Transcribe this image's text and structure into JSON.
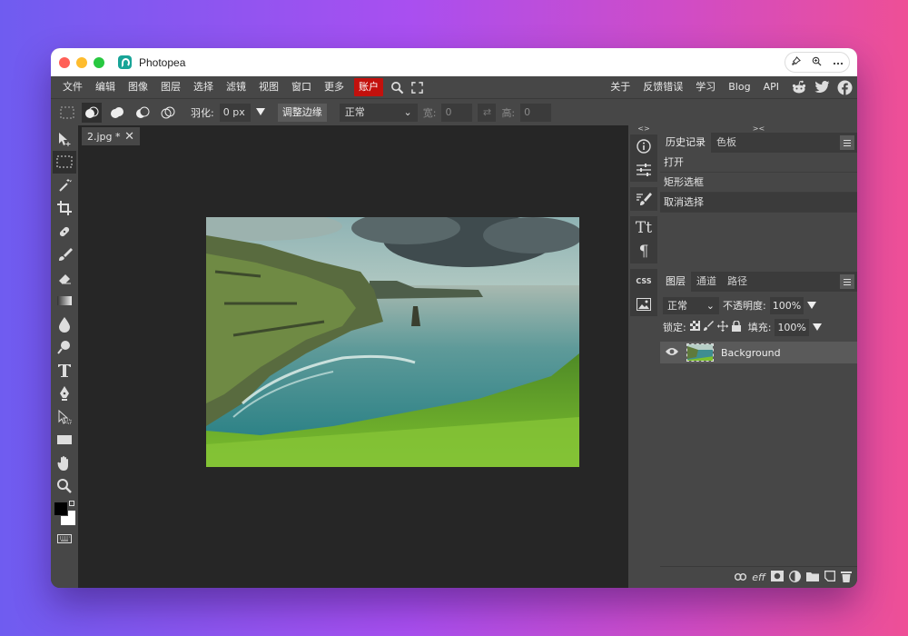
{
  "window": {
    "title": "Photopea",
    "title_buttons": [
      "pin-icon",
      "zoom-icon",
      "more-icon"
    ]
  },
  "menu": {
    "items": [
      "文件",
      "编辑",
      "图像",
      "图层",
      "选择",
      "滤镜",
      "视图",
      "窗口",
      "更多"
    ],
    "account": "账户",
    "right_items": [
      "关于",
      "反馈错误",
      "学习",
      "Blog",
      "API"
    ],
    "account_color": "#c3110d"
  },
  "options": {
    "feather_label": "羽化:",
    "feather_value": "0 px",
    "refine_edge": "调整边缘",
    "style_value": "正常",
    "width_label": "宽:",
    "width_value": "0",
    "height_label": "高:",
    "height_value": "0"
  },
  "document": {
    "tab_name": "2.jpg *"
  },
  "history": {
    "tabs": [
      "历史记录",
      "色板"
    ],
    "items": [
      "打开",
      "矩形选框",
      "取消选择"
    ]
  },
  "layers": {
    "tabs": [
      "图层",
      "通道",
      "路径"
    ],
    "blend_mode": "正常",
    "opacity_label": "不透明度:",
    "opacity_value": "100%",
    "lock_label": "锁定:",
    "fill_label": "填充:",
    "fill_value": "100%",
    "items": [
      {
        "name": "Background"
      }
    ],
    "footer_icons": [
      "link-icon",
      "effects-icon",
      "mask-icon",
      "adjustment-icon",
      "folder-icon",
      "new-layer-icon",
      "trash-icon"
    ],
    "eff_label": "eff"
  },
  "strip": {
    "css_label": "CSS"
  },
  "colors": {
    "foreground": "#000000",
    "background": "#ffffff"
  }
}
